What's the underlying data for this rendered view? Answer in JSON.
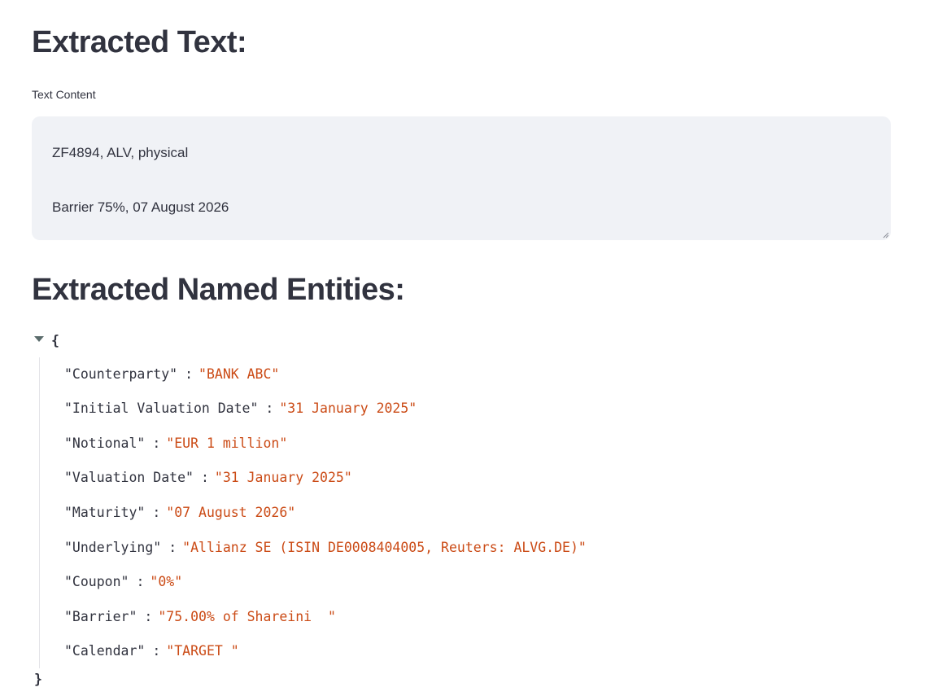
{
  "sections": {
    "extracted_text_title": "Extracted Text:",
    "named_entities_title": "Extracted Named Entities:"
  },
  "text_area": {
    "label": "Text Content",
    "value": "ZF4894, ALV, physical\n\nBarrier 75%, 07 August 2026"
  },
  "json_view": {
    "open_brace": "{",
    "close_brace": "}",
    "entries": [
      {
        "key": "\"Counterparty\"",
        "value": "\"BANK ABC\""
      },
      {
        "key": "\"Initial Valuation Date\"",
        "value": "\"31 January 2025\""
      },
      {
        "key": "\"Notional\"",
        "value": "\"EUR 1 million\""
      },
      {
        "key": "\"Valuation Date\"",
        "value": "\"31 January 2025\""
      },
      {
        "key": "\"Maturity\"",
        "value": "\"07 August 2026\""
      },
      {
        "key": "\"Underlying\"",
        "value": "\"Allianz SE (ISIN DE0008404005, Reuters: ALVG.DE)\""
      },
      {
        "key": "\"Coupon\"",
        "value": "\"0%\""
      },
      {
        "key": "\"Barrier\"",
        "value": "\"75.00% of Shareini  \""
      },
      {
        "key": "\"Calendar\"",
        "value": "\"TARGET \""
      }
    ]
  }
}
